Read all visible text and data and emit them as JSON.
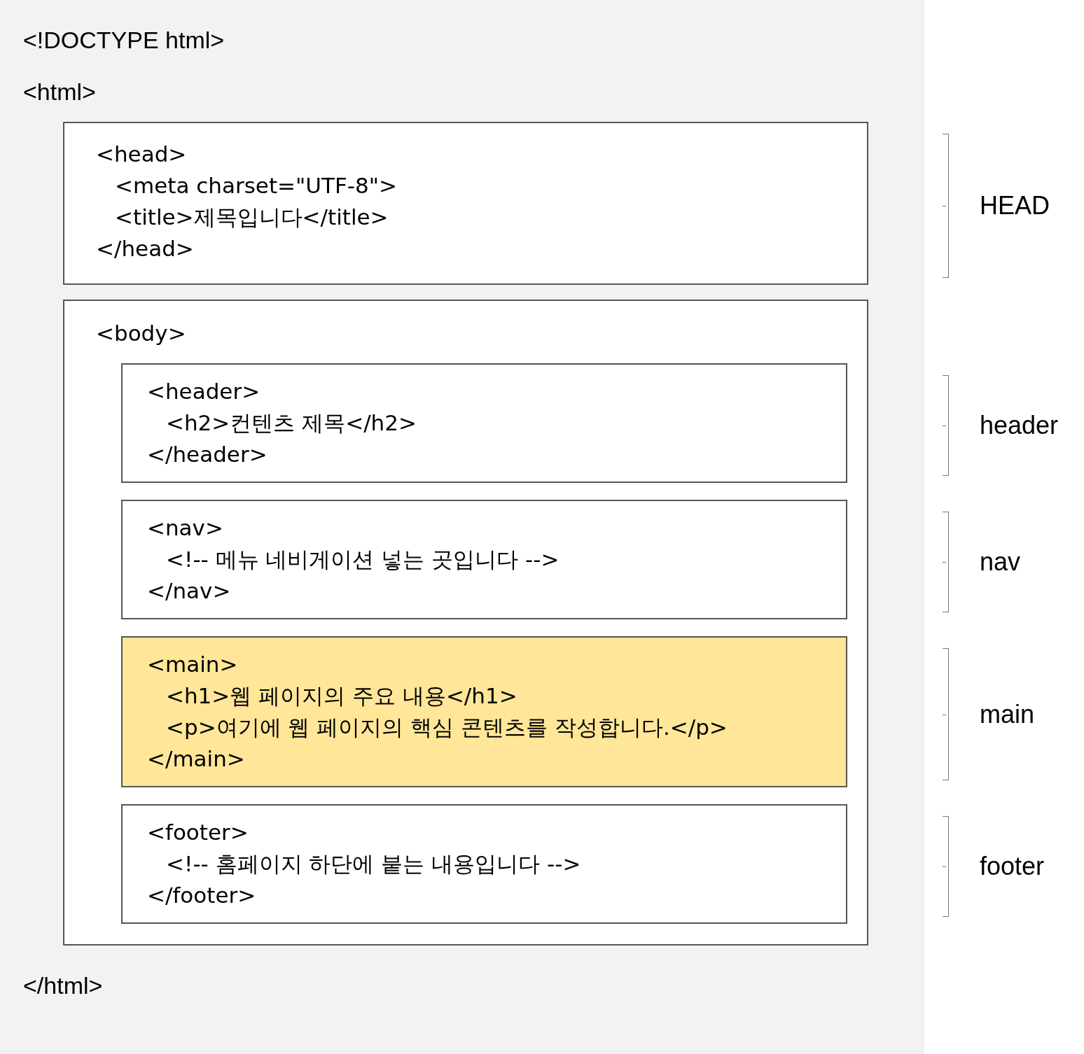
{
  "doctype": "<!DOCTYPE html>",
  "html_open": "<html>",
  "head_block": {
    "open": "<head>",
    "children": [
      "<meta charset=\"UTF-8\">",
      "<title>제목입니다</title>"
    ],
    "close": "</head>",
    "annotation": "HEAD"
  },
  "body_block": {
    "open": "<body>",
    "sections": [
      {
        "open": "<header>",
        "children": [
          "<h2>컨텐츠 제목</h2>"
        ],
        "close": "</header>",
        "highlighted": false,
        "annotation": "header"
      },
      {
        "open": "<nav>",
        "children": [
          "<!-- 메뉴 네비게이션 넣는 곳입니다 -->"
        ],
        "close": "</nav>",
        "highlighted": false,
        "annotation": "nav"
      },
      {
        "open": "<main>",
        "children": [
          "<h1>웹 페이지의 주요 내용</h1>",
          "<p>여기에 웹 페이지의 핵심 콘텐츠를 작성합니다.</p>"
        ],
        "close": "</main>",
        "highlighted": true,
        "annotation": "main"
      },
      {
        "open": "<footer>",
        "children": [
          "<!-- 홈페이지 하단에 붙는 내용입니다 -->"
        ],
        "close": "</footer>",
        "highlighted": false,
        "annotation": "footer"
      }
    ]
  },
  "html_close": "</html>"
}
